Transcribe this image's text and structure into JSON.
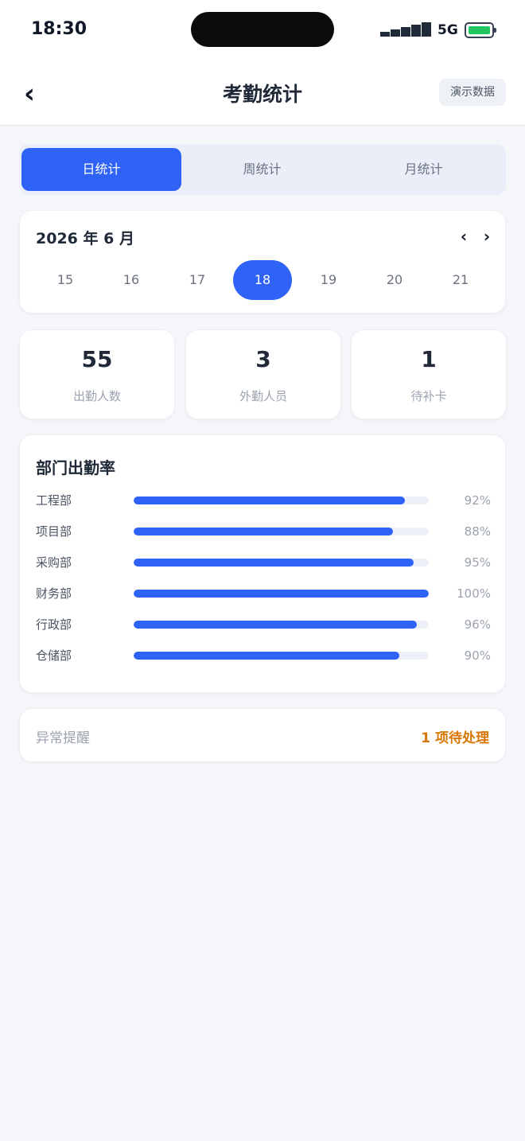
{
  "status_bar": {
    "time": "18:30",
    "network": "5G",
    "battery_level": 1.0,
    "battery_color": "#22c55e"
  },
  "nav": {
    "back_icon": "chevron-left-icon",
    "title": "考勤统计",
    "demo_label": "演示数据"
  },
  "tabs": [
    {
      "label": "日统计",
      "active": true
    },
    {
      "label": "周统计",
      "active": false
    },
    {
      "label": "月统计",
      "active": false
    }
  ],
  "calendar": {
    "month_label": "2026 年 6 月",
    "prev_icon": "chevron-left-icon",
    "next_icon": "chevron-right-icon",
    "days": [
      "15",
      "16",
      "17",
      "18",
      "19",
      "20",
      "21"
    ],
    "selected_day": "18"
  },
  "stats": [
    {
      "value": "55",
      "label": "出勤人数"
    },
    {
      "value": "3",
      "label": "外勤人员"
    },
    {
      "value": "1",
      "label": "待补卡"
    }
  ],
  "dept_section": {
    "title": "部门出勤率",
    "bar_color": "#2f62f6",
    "items": [
      {
        "name": "工程部",
        "percent_label": "92%",
        "value": 92
      },
      {
        "name": "项目部",
        "percent_label": "88%",
        "value": 88
      },
      {
        "name": "采购部",
        "percent_label": "95%",
        "value": 95
      },
      {
        "name": "财务部",
        "percent_label": "100%",
        "value": 100
      },
      {
        "name": "行政部",
        "percent_label": "96%",
        "value": 96
      },
      {
        "name": "仓储部",
        "percent_label": "90%",
        "value": 90
      }
    ]
  },
  "alert": {
    "label": "异常提醒",
    "value": "1 项待处理",
    "accent": "#d97706"
  }
}
